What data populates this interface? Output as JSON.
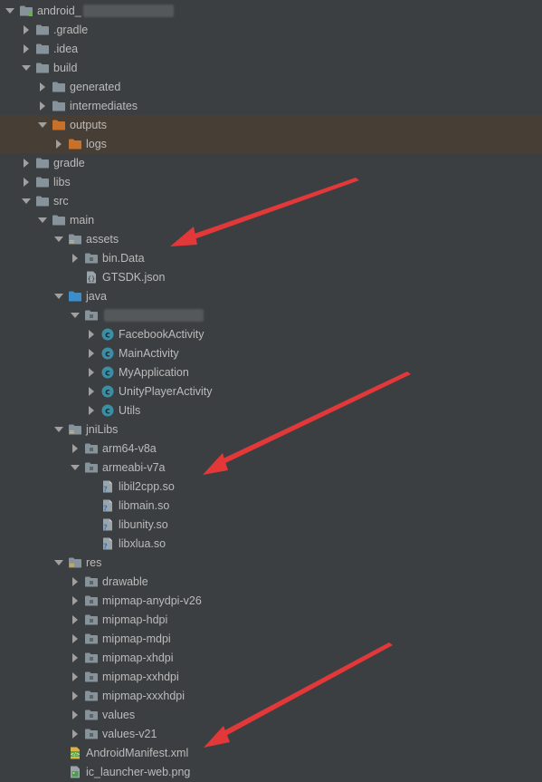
{
  "colors": {
    "background": "#3c3f41",
    "highlight_row": "#473f36",
    "text": "#bbbbbb",
    "folder": "#87939a",
    "folder_excluded": "#c8712a",
    "folder_java": "#3b8ecd",
    "class_icon": "#3a8fa5",
    "annotation_arrow": "#e2383a"
  },
  "tree": [
    {
      "label": "android_",
      "depth": 0,
      "expanded": true,
      "icon": "module-folder-icon",
      "redacted": true
    },
    {
      "label": ".gradle",
      "depth": 1,
      "expanded": false,
      "icon": "folder-icon"
    },
    {
      "label": ".idea",
      "depth": 1,
      "expanded": false,
      "icon": "folder-icon"
    },
    {
      "label": "build",
      "depth": 1,
      "expanded": true,
      "icon": "folder-icon"
    },
    {
      "label": "generated",
      "depth": 2,
      "expanded": false,
      "icon": "folder-icon"
    },
    {
      "label": "intermediates",
      "depth": 2,
      "expanded": false,
      "icon": "folder-icon"
    },
    {
      "label": "outputs",
      "depth": 2,
      "expanded": true,
      "icon": "excluded-folder-icon",
      "highlight": true
    },
    {
      "label": "logs",
      "depth": 3,
      "expanded": false,
      "icon": "excluded-folder-icon",
      "highlight": true
    },
    {
      "label": "gradle",
      "depth": 1,
      "expanded": false,
      "icon": "folder-icon"
    },
    {
      "label": "libs",
      "depth": 1,
      "expanded": false,
      "icon": "folder-icon"
    },
    {
      "label": "src",
      "depth": 1,
      "expanded": true,
      "icon": "folder-icon"
    },
    {
      "label": "main",
      "depth": 2,
      "expanded": true,
      "icon": "folder-icon"
    },
    {
      "label": "assets",
      "depth": 3,
      "expanded": true,
      "icon": "resource-folder-icon"
    },
    {
      "label": "bin.Data",
      "depth": 4,
      "expanded": false,
      "icon": "package-folder-icon"
    },
    {
      "label": "GTSDK.json",
      "depth": 4,
      "leaf": true,
      "icon": "json-file-icon"
    },
    {
      "label": "java",
      "depth": 3,
      "expanded": true,
      "icon": "source-folder-icon"
    },
    {
      "label": "",
      "depth": 4,
      "expanded": true,
      "icon": "package-folder-icon",
      "redacted": true
    },
    {
      "label": "FacebookActivity",
      "depth": 5,
      "expanded": false,
      "icon": "class-icon"
    },
    {
      "label": "MainActivity",
      "depth": 5,
      "expanded": false,
      "icon": "class-icon"
    },
    {
      "label": "MyApplication",
      "depth": 5,
      "expanded": false,
      "icon": "class-icon"
    },
    {
      "label": "UnityPlayerActivity",
      "depth": 5,
      "expanded": false,
      "icon": "class-icon"
    },
    {
      "label": "Utils",
      "depth": 5,
      "expanded": false,
      "icon": "class-icon"
    },
    {
      "label": "jniLibs",
      "depth": 3,
      "expanded": true,
      "icon": "resource-folder-icon"
    },
    {
      "label": "arm64-v8a",
      "depth": 4,
      "expanded": false,
      "icon": "package-folder-icon"
    },
    {
      "label": "armeabi-v7a",
      "depth": 4,
      "expanded": true,
      "icon": "package-folder-icon"
    },
    {
      "label": "libil2cpp.so",
      "depth": 5,
      "leaf": true,
      "icon": "unknown-file-icon"
    },
    {
      "label": "libmain.so",
      "depth": 5,
      "leaf": true,
      "icon": "unknown-file-icon"
    },
    {
      "label": "libunity.so",
      "depth": 5,
      "leaf": true,
      "icon": "unknown-file-icon"
    },
    {
      "label": "libxlua.so",
      "depth": 5,
      "leaf": true,
      "icon": "unknown-file-icon"
    },
    {
      "label": "res",
      "depth": 3,
      "expanded": true,
      "icon": "resource-folder-icon"
    },
    {
      "label": "drawable",
      "depth": 4,
      "expanded": false,
      "icon": "package-folder-icon"
    },
    {
      "label": "mipmap-anydpi-v26",
      "depth": 4,
      "expanded": false,
      "icon": "package-folder-icon"
    },
    {
      "label": "mipmap-hdpi",
      "depth": 4,
      "expanded": false,
      "icon": "package-folder-icon"
    },
    {
      "label": "mipmap-mdpi",
      "depth": 4,
      "expanded": false,
      "icon": "package-folder-icon"
    },
    {
      "label": "mipmap-xhdpi",
      "depth": 4,
      "expanded": false,
      "icon": "package-folder-icon"
    },
    {
      "label": "mipmap-xxhdpi",
      "depth": 4,
      "expanded": false,
      "icon": "package-folder-icon"
    },
    {
      "label": "mipmap-xxxhdpi",
      "depth": 4,
      "expanded": false,
      "icon": "package-folder-icon"
    },
    {
      "label": "values",
      "depth": 4,
      "expanded": false,
      "icon": "package-folder-icon"
    },
    {
      "label": "values-v21",
      "depth": 4,
      "expanded": false,
      "icon": "package-folder-icon"
    },
    {
      "label": "AndroidManifest.xml",
      "depth": 3,
      "leaf": true,
      "icon": "manifest-file-icon"
    },
    {
      "label": "ic_launcher-web.png",
      "depth": 3,
      "leaf": true,
      "icon": "image-file-icon"
    }
  ],
  "annotations": [
    {
      "name": "arrow-to-assets",
      "points_to": "assets"
    },
    {
      "name": "arrow-to-armeabi-v7a",
      "points_to": "armeabi-v7a"
    },
    {
      "name": "arrow-to-androidmanifest",
      "points_to": "AndroidManifest.xml"
    }
  ]
}
